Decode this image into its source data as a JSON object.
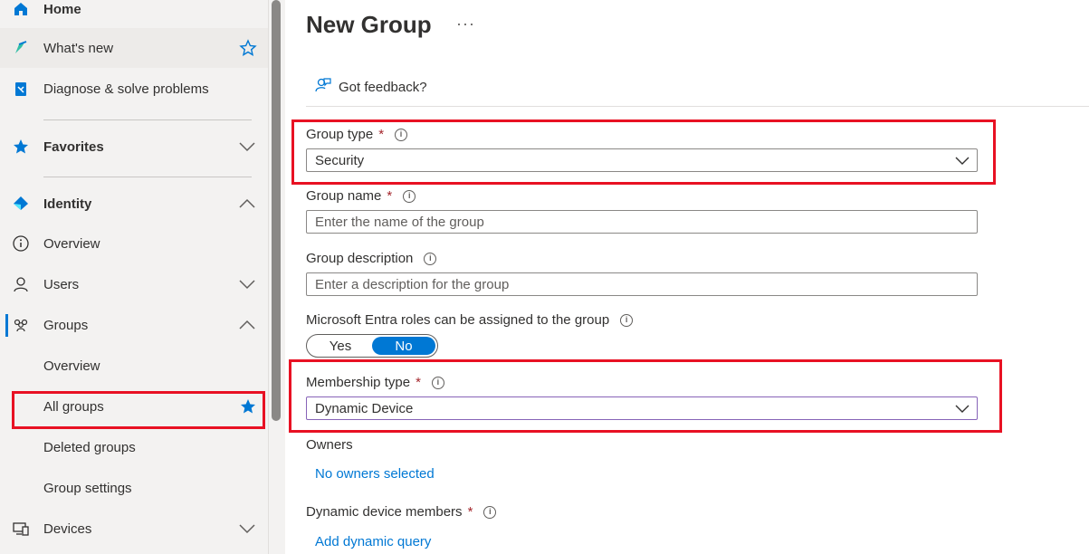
{
  "sidebar": {
    "home": "Home",
    "whats_new": "What's new",
    "diagnose": "Diagnose & solve problems",
    "favorites": "Favorites",
    "identity": "Identity",
    "overview": "Overview",
    "users": "Users",
    "groups": "Groups",
    "groups_overview": "Overview",
    "all_groups": "All groups",
    "deleted_groups": "Deleted groups",
    "group_settings": "Group settings",
    "devices": "Devices"
  },
  "page": {
    "title": "New Group",
    "more": "···",
    "feedback": "Got feedback?"
  },
  "form": {
    "group_type_label": "Group type",
    "group_type_value": "Security",
    "group_name_label": "Group name",
    "group_name_placeholder": "Enter the name of the group",
    "group_description_label": "Group description",
    "group_description_placeholder": "Enter a description for the group",
    "entra_roles_label": "Microsoft Entra roles can be assigned to the group",
    "toggle_yes": "Yes",
    "toggle_no": "No",
    "toggle_selected": "No",
    "membership_type_label": "Membership type",
    "membership_type_value": "Dynamic Device",
    "owners_label": "Owners",
    "owners_link": "No owners selected",
    "dynamic_members_label": "Dynamic device members",
    "dynamic_query_link": "Add dynamic query",
    "required_mark": "*",
    "info_mark": "i"
  },
  "colors": {
    "accent": "#0078d4",
    "highlight": "#e81123",
    "required": "#a4262c"
  }
}
